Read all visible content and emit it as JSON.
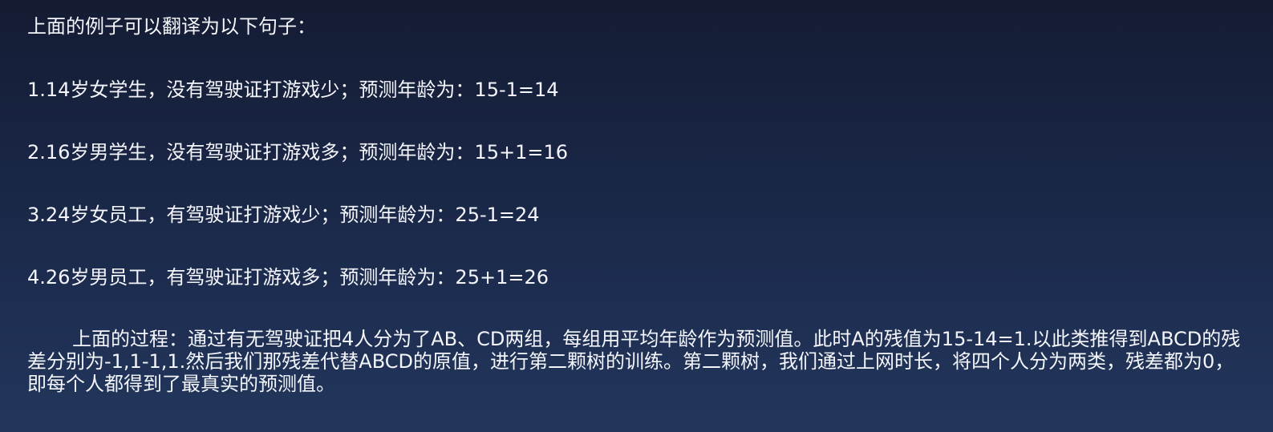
{
  "intro": "上面的例子可以翻译为以下句子：",
  "items": [
    "1.14岁女学生，没有驾驶证打游戏少；预测年龄为：15-1=14",
    "2.16岁男学生，没有驾驶证打游戏多；预测年龄为：15+1=16",
    "3.24岁女员工，有驾驶证打游戏少；预测年龄为：25-1=24",
    "4.26岁男员工，有驾驶证打游戏多；预测年龄为：25+1=26"
  ],
  "paragraph": "上面的过程：通过有无驾驶证把4人分为了AB、CD两组，每组用平均年龄作为预测值。此时A的残值为15-14=1.以此类推得到ABCD的残差分别为-1,1-1,1.然后我们那残差代替ABCD的原值，进行第二颗树的训练。第二颗树，我们通过上网时长，将四个人分为两类，残差都为0，即每个人都得到了最真实的预测值。"
}
